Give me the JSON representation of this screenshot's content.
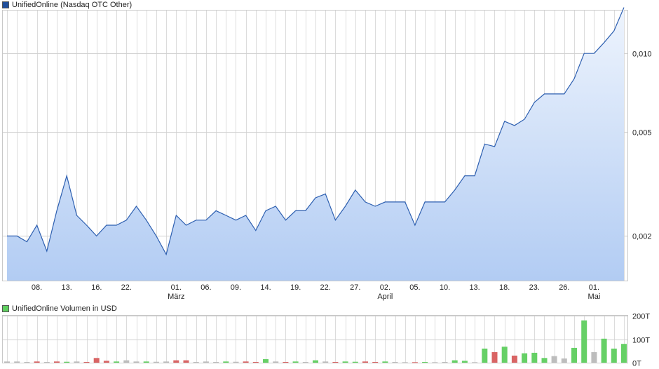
{
  "price_legend": {
    "label": "UnifiedOnline (Nasdaq OTC Other)",
    "color": "#1f4e9c"
  },
  "volume_legend": {
    "label": "UnifiedOnline Volumen in USD",
    "color": "#5fcf5f"
  },
  "colors": {
    "line": "#2d5fb0",
    "up": "#66d066",
    "down": "#d96464",
    "flat": "#bdbdbd",
    "grid": "#dcdcdc"
  },
  "chart_data": [
    {
      "type": "area",
      "y_scale": "log",
      "ylim": [
        0.00135,
        0.0146
      ],
      "yticks": [
        {
          "value": 0.002,
          "label": "0,002"
        },
        {
          "value": 0.005,
          "label": "0,005"
        },
        {
          "value": 0.01,
          "label": "0,010"
        }
      ],
      "xticks": [
        {
          "i": 3,
          "label": "08."
        },
        {
          "i": 6,
          "label": "13."
        },
        {
          "i": 9,
          "label": "16."
        },
        {
          "i": 12,
          "label": "22."
        },
        {
          "i": 17,
          "label": "01.",
          "sub": "März"
        },
        {
          "i": 20,
          "label": "06."
        },
        {
          "i": 23,
          "label": "09."
        },
        {
          "i": 26,
          "label": "14."
        },
        {
          "i": 29,
          "label": "19."
        },
        {
          "i": 32,
          "label": "22."
        },
        {
          "i": 35,
          "label": "27."
        },
        {
          "i": 38,
          "label": "02.",
          "sub": "April"
        },
        {
          "i": 41,
          "label": "05."
        },
        {
          "i": 44,
          "label": "10."
        },
        {
          "i": 47,
          "label": "13."
        },
        {
          "i": 50,
          "label": "18."
        },
        {
          "i": 53,
          "label": "23."
        },
        {
          "i": 56,
          "label": "26."
        },
        {
          "i": 59,
          "label": "01.",
          "sub": "Mai"
        }
      ],
      "values": [
        0.002,
        0.002,
        0.0019,
        0.0022,
        0.00175,
        0.0025,
        0.0034,
        0.0024,
        0.0022,
        0.002,
        0.0022,
        0.0022,
        0.0023,
        0.0026,
        0.0023,
        0.002,
        0.0017,
        0.0024,
        0.0022,
        0.0023,
        0.0023,
        0.0025,
        0.0024,
        0.0023,
        0.0024,
        0.0021,
        0.0025,
        0.0026,
        0.0023,
        0.0025,
        0.0025,
        0.0028,
        0.0029,
        0.0023,
        0.0026,
        0.003,
        0.0027,
        0.0026,
        0.0027,
        0.0027,
        0.0027,
        0.0022,
        0.0027,
        0.0027,
        0.0027,
        0.003,
        0.0034,
        0.0034,
        0.0045,
        0.0044,
        0.0055,
        0.0053,
        0.0056,
        0.0065,
        0.007,
        0.007,
        0.007,
        0.008,
        0.01,
        0.01,
        0.011,
        0.0122,
        0.015
      ]
    },
    {
      "type": "bar",
      "ylim": [
        0,
        200
      ],
      "yticks": [
        {
          "value": 0,
          "label": "0T"
        },
        {
          "value": 100,
          "label": "100T"
        },
        {
          "value": 200,
          "label": "200T"
        }
      ],
      "values": [
        5,
        5,
        3,
        5,
        3,
        5,
        4,
        5,
        3,
        20,
        8,
        5,
        10,
        5,
        5,
        4,
        5,
        10,
        10,
        3,
        5,
        3,
        5,
        4,
        5,
        3,
        15,
        5,
        3,
        5,
        3,
        10,
        5,
        3,
        5,
        4,
        5,
        3,
        5,
        3,
        2,
        2,
        3,
        2,
        3,
        10,
        8,
        2,
        60,
        45,
        68,
        30,
        40,
        42,
        20,
        28,
        18,
        63,
        180,
        45,
        102,
        60,
        80
      ],
      "directions": [
        "flat",
        "flat",
        "flat",
        "down",
        "flat",
        "down",
        "up",
        "flat",
        "down",
        "down",
        "down",
        "up",
        "flat",
        "flat",
        "up",
        "flat",
        "flat",
        "down",
        "down",
        "flat",
        "flat",
        "flat",
        "up",
        "flat",
        "down",
        "down",
        "up",
        "flat",
        "down",
        "up",
        "flat",
        "up",
        "flat",
        "down",
        "up",
        "up",
        "down",
        "down",
        "up",
        "flat",
        "flat",
        "down",
        "up",
        "flat",
        "flat",
        "up",
        "up",
        "flat",
        "up",
        "down",
        "up",
        "down",
        "up",
        "up",
        "up",
        "flat",
        "flat",
        "up",
        "up",
        "flat",
        "up",
        "up",
        "up"
      ]
    }
  ]
}
